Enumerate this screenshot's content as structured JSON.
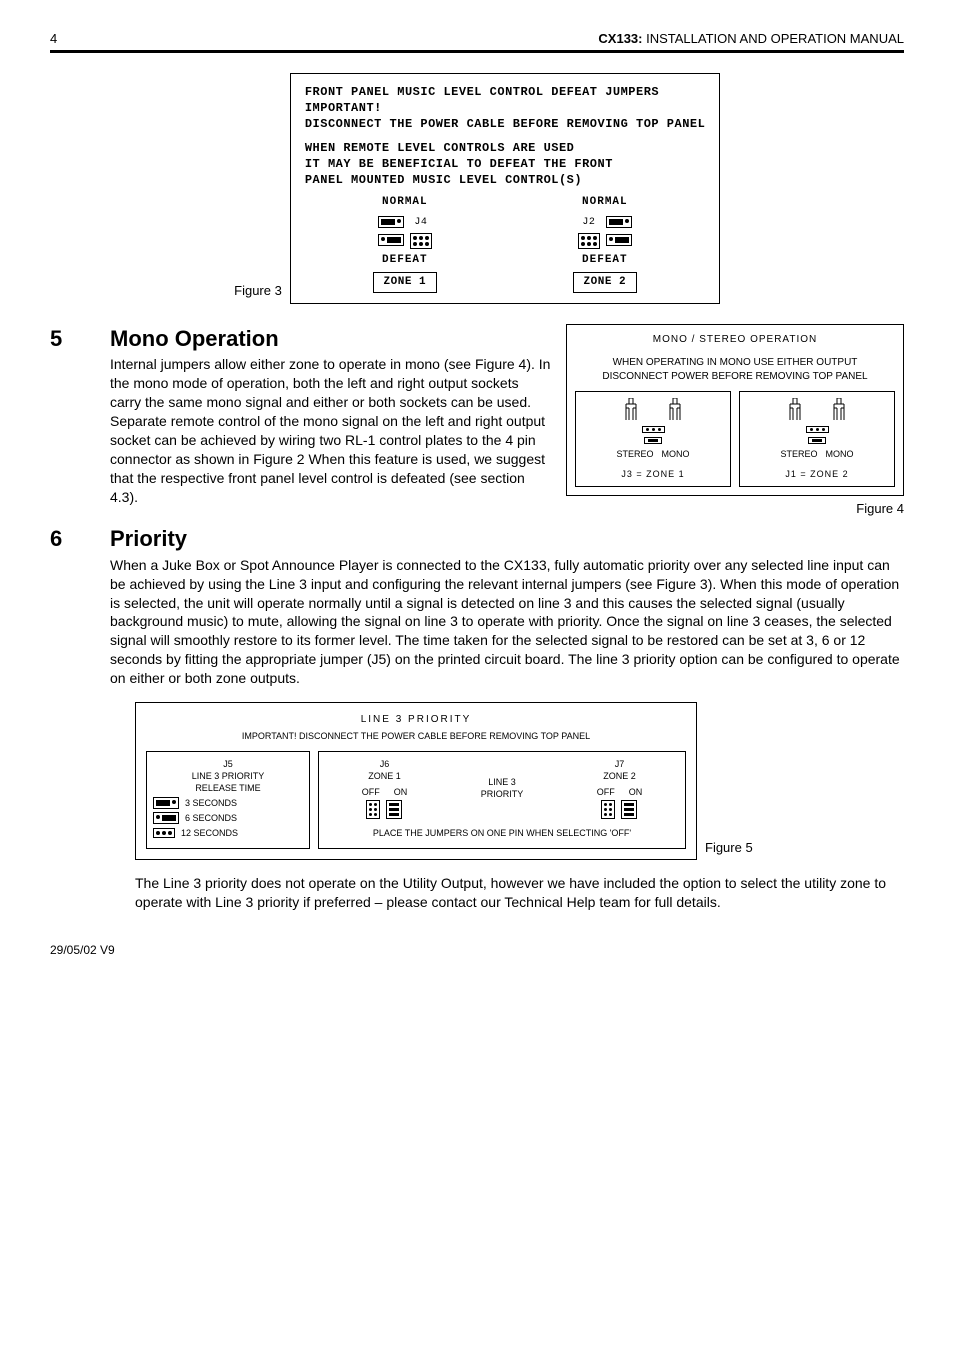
{
  "header": {
    "page_number": "4",
    "product": "CX133:",
    "doc_title": "INSTALLATION AND OPERATION MANUAL"
  },
  "figure3": {
    "caption": "Figure 3",
    "title": "FRONT PANEL MUSIC LEVEL CONTROL DEFEAT JUMPERS",
    "important": "IMPORTANT!",
    "warning": "DISCONNECT THE POWER CABLE BEFORE REMOVING TOP PANEL",
    "note1": "WHEN REMOTE LEVEL CONTROLS ARE USED",
    "note2": "IT MAY BE BENEFICIAL TO DEFEAT THE FRONT",
    "note3": "PANEL MOUNTED MUSIC LEVEL CONTROL(S)",
    "normal": "NORMAL",
    "j4": "J4",
    "j2": "J2",
    "defeat": "DEFEAT",
    "zone1": "ZONE 1",
    "zone2": "ZONE 2"
  },
  "section5": {
    "num": "5",
    "title": "Mono Operation",
    "body": "Internal jumpers allow either zone to operate in mono (see Figure 4). In the mono mode of operation, both the left and right output sockets carry the same mono signal and either or both sockets can be used. Separate remote control of the mono signal on the left and right output socket can be achieved by wiring two RL-1 control plates to the 4 pin connector as shown in Figure 2 When this feature is used, we suggest that the respective front panel level control is defeated (see section 4.3)."
  },
  "figure4": {
    "caption": "Figure 4",
    "title": "MONO / STEREO OPERATION",
    "note1": "WHEN OPERATING IN MONO USE EITHER OUTPUT",
    "note2": "DISCONNECT POWER BEFORE REMOVING TOP PANEL",
    "stereo": "STEREO",
    "mono": "MONO",
    "j3": "J3  =  ZONE  1",
    "j1": "J1  =  ZONE  2"
  },
  "section6": {
    "num": "6",
    "title": "Priority",
    "body": "When a Juke Box or Spot Announce Player is connected to the CX133, fully automatic priority over any selected line input can be achieved by using the Line 3 input and configuring the relevant internal jumpers (see Figure 3). When this mode of operation is selected, the unit will operate normally until a signal is detected on line 3 and this causes the selected signal (usually background music) to mute, allowing the signal on line 3 to operate with priority. Once the signal on line 3 ceases, the selected signal will smoothly restore to its former level. The time taken for the selected signal to be restored can be set at 3, 6 or 12 seconds by fitting the appropriate jumper (J5) on the printed circuit board. The line 3 priority option can be configured to operate on either or both zone outputs.",
    "body2": "The Line 3 priority does not operate on the Utility Output, however we have included the option to select the utility zone to operate with Line 3 priority if preferred – please contact our Technical Help team for full details."
  },
  "figure5": {
    "caption": "Figure 5",
    "title": "LINE  3  PRIORITY",
    "warning": "IMPORTANT! DISCONNECT THE POWER CABLE BEFORE REMOVING TOP PANEL",
    "j5": "J5",
    "j5_sub1": "LINE 3 PRIORITY",
    "j5_sub2": "RELEASE TIME",
    "opt3": "3  SECONDS",
    "opt6": "6  SECONDS",
    "opt12": "12  SECONDS",
    "j6": "J6",
    "zone1": "ZONE  1",
    "j7": "J7",
    "zone2": "ZONE  2",
    "off": "OFF",
    "on": "ON",
    "line3": "LINE 3",
    "priority": "PRIORITY",
    "footnote": "PLACE THE JUMPERS ON ONE PIN WHEN SELECTING 'OFF'"
  },
  "footer": {
    "text": "29/05/02 V9"
  }
}
